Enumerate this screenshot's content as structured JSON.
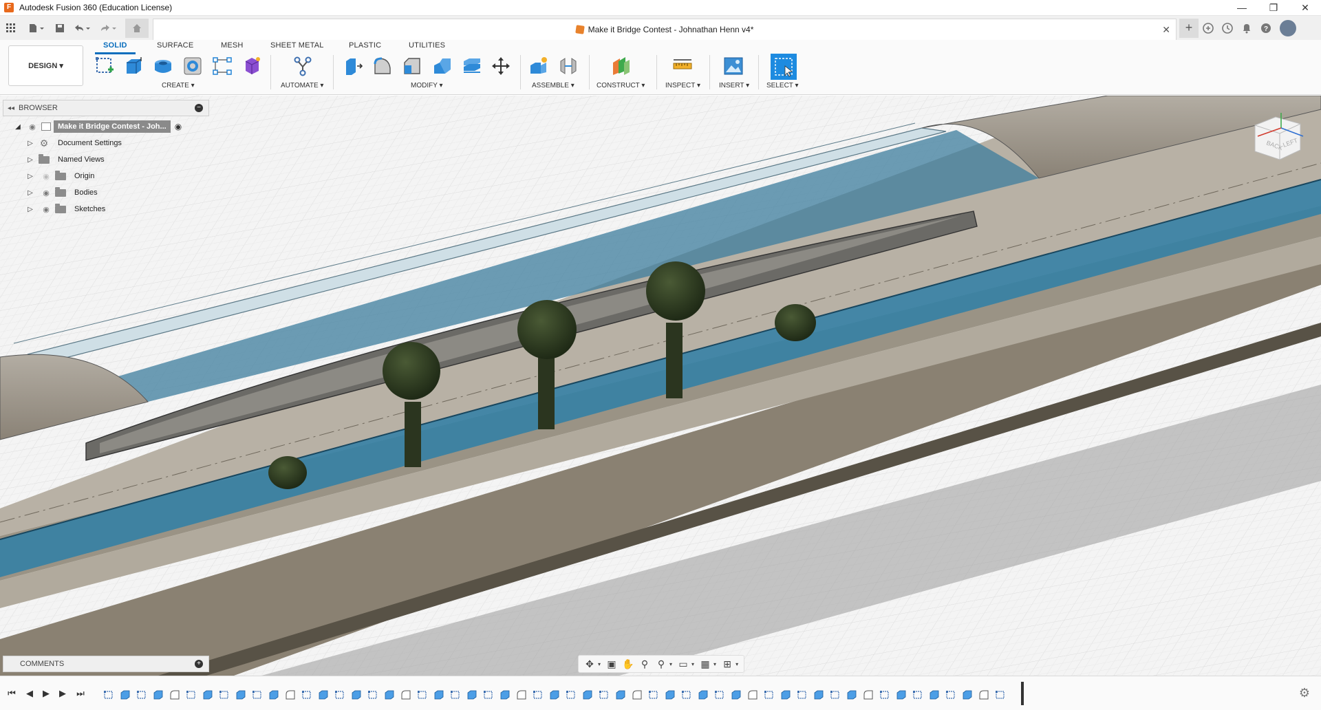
{
  "window": {
    "title": "Autodesk Fusion 360 (Education License)",
    "controls": [
      "—",
      "❐",
      "✕"
    ]
  },
  "quick_access": {
    "grid_icon": "apps-grid-icon",
    "file_icon": "file-icon",
    "save_icon": "save-icon",
    "undo_icon": "undo-icon",
    "redo_icon": "redo-icon",
    "home_icon": "home-icon"
  },
  "document_tab": {
    "title": "Make it Bridge Contest - Johnathan Henn v4*",
    "close": "✕"
  },
  "ribbon": {
    "tabs": [
      "SOLID",
      "SURFACE",
      "MESH",
      "SHEET METAL",
      "PLASTIC",
      "UTILITIES"
    ],
    "active_tab": "SOLID",
    "workspace": "DESIGN ▾",
    "groups": {
      "create": "CREATE ▾",
      "automate": "AUTOMATE ▾",
      "modify": "MODIFY ▾",
      "assemble": "ASSEMBLE ▾",
      "construct": "CONSTRUCT ▾",
      "inspect": "INSPECT ▾",
      "insert": "INSERT ▾",
      "select": "SELECT ▾"
    }
  },
  "browser": {
    "title": "BROWSER",
    "root": "Make it Bridge Contest - Joh...",
    "items": [
      {
        "label": "Document Settings",
        "icon": "gear-icon"
      },
      {
        "label": "Named Views",
        "icon": "folder-icon"
      },
      {
        "label": "Origin",
        "icon": "folder-icon"
      },
      {
        "label": "Bodies",
        "icon": "folder-icon"
      },
      {
        "label": "Sketches",
        "icon": "folder-icon"
      }
    ]
  },
  "viewcube": {
    "faces": [
      "BACK",
      "LEFT"
    ]
  },
  "comments": {
    "title": "COMMENTS"
  },
  "navbar": {
    "icons": [
      "orbit-icon",
      "look-at-icon",
      "pan-icon",
      "zoom-icon",
      "zoom-window-icon",
      "display-settings-icon",
      "grid-icon",
      "viewports-icon"
    ]
  },
  "timeline": {
    "controls": [
      "go-to-start-icon",
      "step-back-icon",
      "play-icon",
      "step-forward-icon",
      "go-to-end-icon"
    ],
    "feature_count": 55
  },
  "colors": {
    "accent": "#0a6ebd",
    "glass": "#2f7fa6",
    "stone": "#8a8276",
    "tree": "#2f3b22"
  }
}
